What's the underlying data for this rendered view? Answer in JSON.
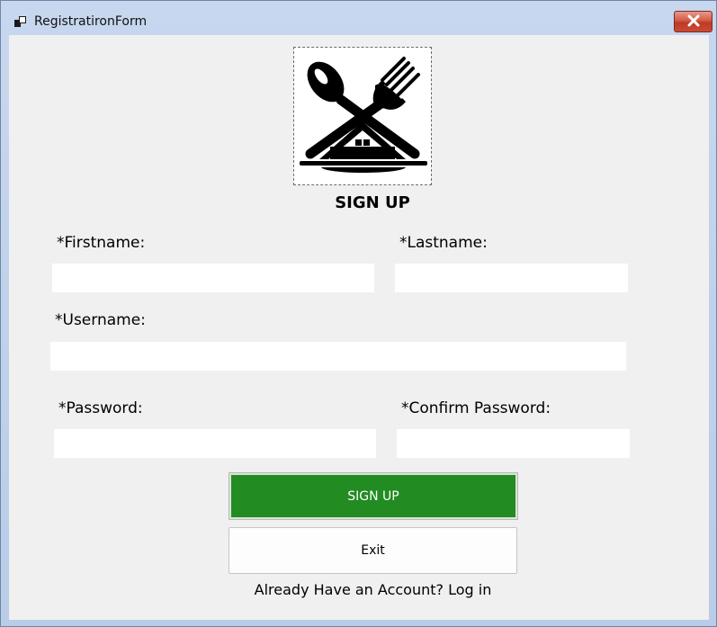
{
  "window": {
    "title": "RegistratironForm",
    "close_icon": "close-x-icon",
    "app_icon": "form-icon"
  },
  "logo": {
    "icon": "spoon-fork-house-plate-logo"
  },
  "form": {
    "heading": "SIGN UP",
    "firstname_label": "*Firstname:",
    "firstname_value": "",
    "lastname_label": "*Lastname:",
    "lastname_value": "",
    "username_label": "*Username:",
    "username_value": "",
    "password_label": "*Password:",
    "password_value": "",
    "confirm_password_label": "*Confirm Password:",
    "confirm_password_value": ""
  },
  "buttons": {
    "signup_label": "SIGN UP",
    "exit_label": "Exit",
    "signup_color": "#228b22"
  },
  "footer": {
    "login_text": "Already Have an Account? Log in"
  }
}
